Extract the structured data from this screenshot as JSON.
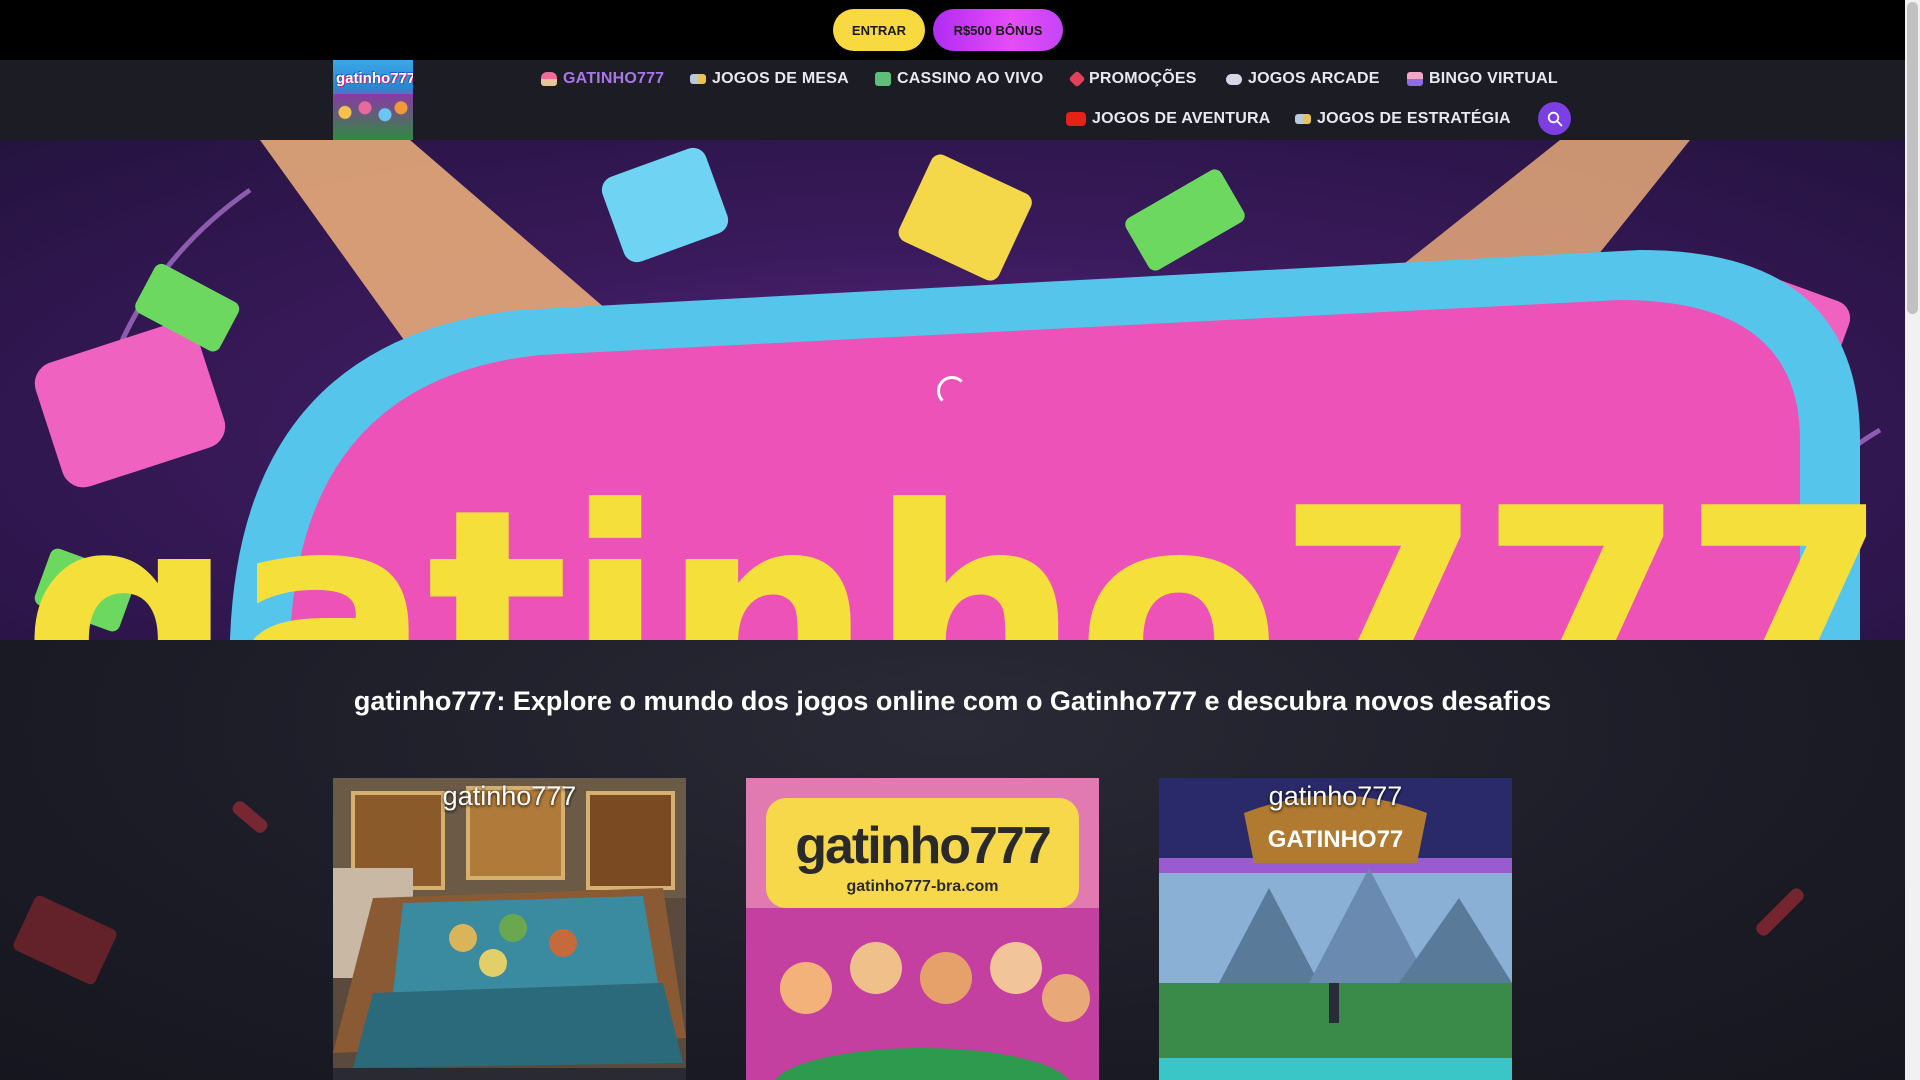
{
  "topbar": {
    "login_label": "ENTRAR",
    "bonus_label": "R$500 BÔNUS"
  },
  "header": {
    "logo_text": "gatinho777",
    "nav": [
      {
        "label": "GATINHO777",
        "icon": "cupcake-icon",
        "active": true
      },
      {
        "label": "JOGOS DE MESA",
        "icon": "cards-icon",
        "active": false
      },
      {
        "label": "CASSINO AO VIVO",
        "icon": "casino-icon",
        "active": false
      },
      {
        "label": "PROMOÇÕES",
        "icon": "dice-icon",
        "active": false
      },
      {
        "label": "JOGOS ARCADE",
        "icon": "gamepad-icon",
        "active": false
      },
      {
        "label": "BINGO VIRTUAL",
        "icon": "bingo-icon",
        "active": false
      },
      {
        "label": "JOGOS DE AVENTURA",
        "icon": "youtube-icon",
        "active": false
      },
      {
        "label": "JOGOS DE ESTRATÉGIA",
        "icon": "cards-icon",
        "active": false
      }
    ],
    "search_icon": "search-icon"
  },
  "banner": {
    "logo_word_main": "gatinho",
    "logo_word_num": "777"
  },
  "main": {
    "headline": "gatinho777: Explore o mundo dos jogos online com o Gatinho777 e descubra novos desafios",
    "cards": [
      {
        "title": "gatinho777",
        "image": "board-game-table"
      },
      {
        "title": "",
        "image_text": "gatinho777",
        "image_subtext": "gatinho777-bra.com"
      },
      {
        "title": "gatinho777",
        "image_text": "GATINHO77",
        "image": "fantasy-landscape"
      }
    ]
  },
  "colors": {
    "accent": "#7b3fe4",
    "active_nav": "#a977e8",
    "login_bg": "#f8d93f",
    "bonus_bg": "#d442f6"
  }
}
